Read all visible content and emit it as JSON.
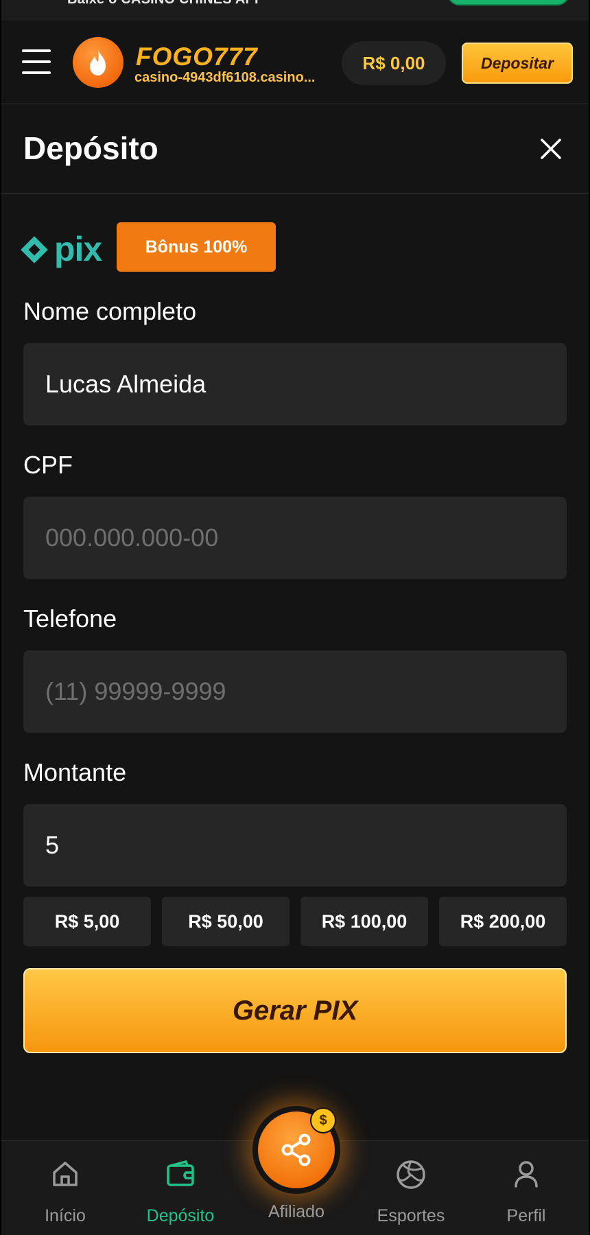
{
  "banner": {
    "text": "Baixe o CASINO CHINES APP"
  },
  "header": {
    "brand": "FOGO777",
    "domain": "casino-4943df6108.casino...",
    "balance": "R$ 0,00",
    "deposit_button": "Depositar"
  },
  "dialog": {
    "title": "Depósito",
    "payment_method": "pix",
    "bonus_badge": "Bônus 100%"
  },
  "form": {
    "name": {
      "label": "Nome completo",
      "value": "Lucas Almeida",
      "placeholder": ""
    },
    "cpf": {
      "label": "CPF",
      "value": "",
      "placeholder": "000.000.000-00"
    },
    "phone": {
      "label": "Telefone",
      "value": "",
      "placeholder": "(11) 99999-9999"
    },
    "amount": {
      "label": "Montante",
      "value": "5",
      "placeholder": ""
    },
    "quick_amounts": [
      "R$ 5,00",
      "R$ 50,00",
      "R$ 100,00",
      "R$ 200,00"
    ],
    "submit_label": "Gerar PIX"
  },
  "nav": {
    "items": [
      {
        "label": "Início",
        "icon": "home-icon",
        "active": false
      },
      {
        "label": "Depósito",
        "icon": "wallet-icon",
        "active": true
      },
      {
        "label": "Afiliado",
        "icon": "share-icon",
        "active": false
      },
      {
        "label": "Esportes",
        "icon": "volleyball-icon",
        "active": false
      },
      {
        "label": "Perfil",
        "icon": "user-icon",
        "active": false
      }
    ],
    "fab_badge": "$"
  },
  "colors": {
    "accent": "#f99a0c",
    "brand": "#ffb21e",
    "pix": "#32bcad",
    "active_nav": "#22c38a",
    "background": "#141414"
  }
}
